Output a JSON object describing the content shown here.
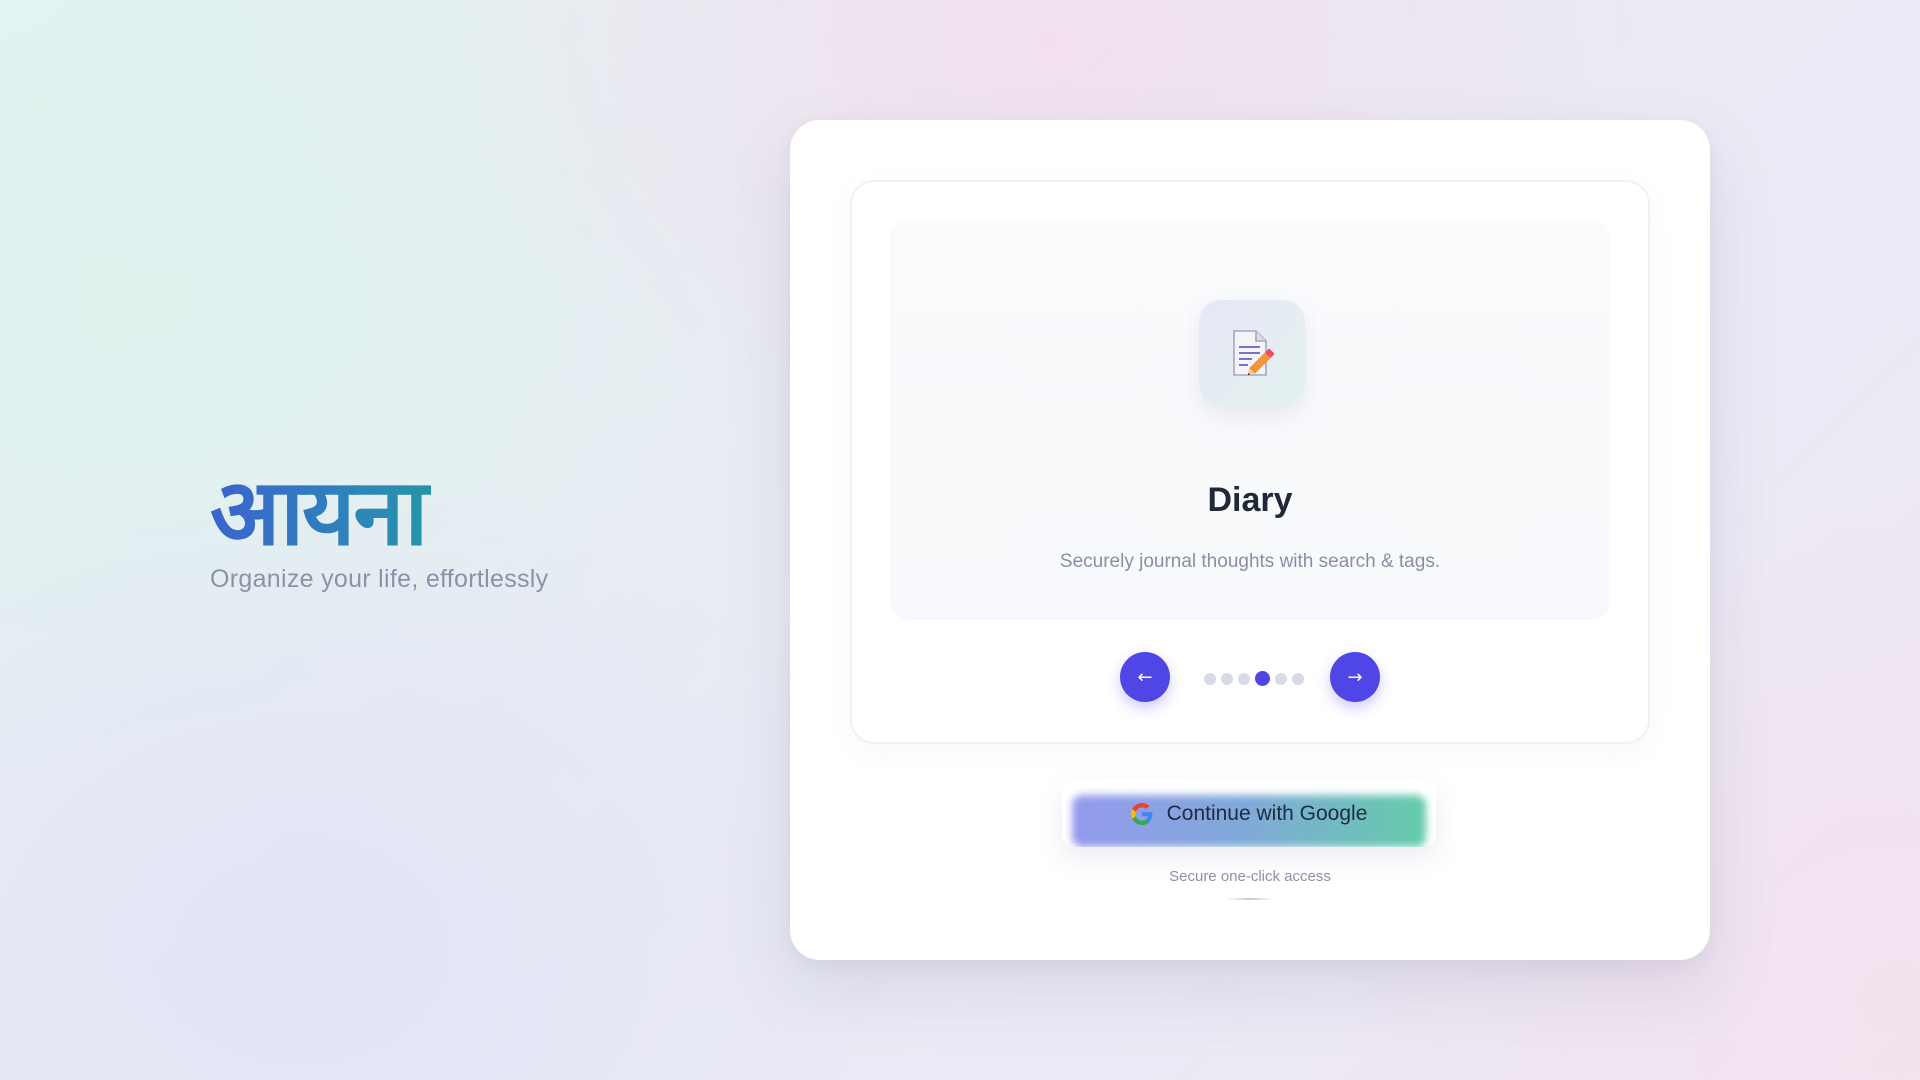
{
  "brand": {
    "title": "आयना",
    "tagline": "Organize your life, effortlessly"
  },
  "carousel": {
    "current_slide": {
      "icon": "memo-pencil-icon",
      "title": "Diary",
      "description": "Securely journal thoughts with search & tags."
    },
    "prev_label": "←",
    "next_label": "→",
    "slide_count": 6,
    "active_index": 3
  },
  "auth": {
    "google_button_label": "Continue with Google",
    "google_icon": "google-g-icon",
    "secure_note": "Secure one-click access"
  },
  "colors": {
    "accent": "#4f46e5",
    "brand_gradient_start": "#3b63cf",
    "brand_gradient_end": "#16b088",
    "title_text": "#1f2937",
    "muted_text": "#8790a3"
  }
}
